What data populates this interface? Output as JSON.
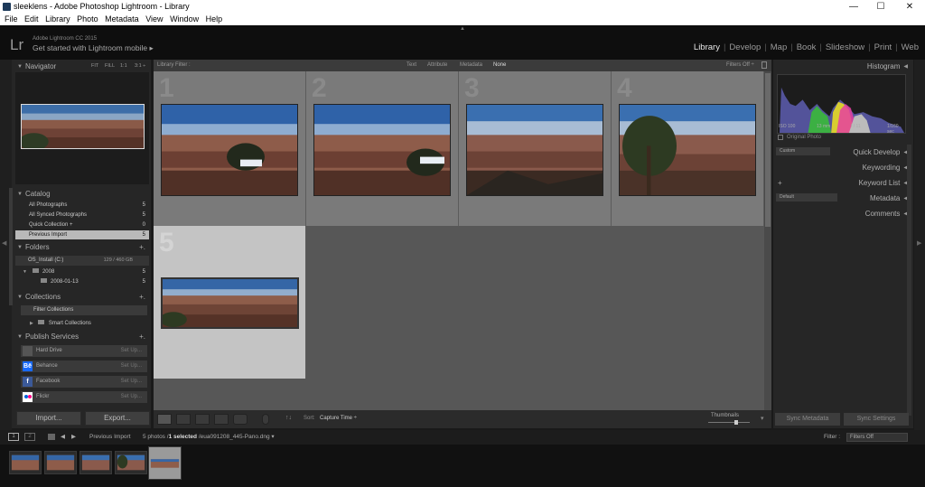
{
  "window": {
    "title": "sleeklens - Adobe Photoshop Lightroom - Library",
    "minimize": "—",
    "maximize": "☐",
    "close": "✕"
  },
  "menu": [
    "File",
    "Edit",
    "Library",
    "Photo",
    "Metadata",
    "View",
    "Window",
    "Help"
  ],
  "identity": {
    "logo": "Lr",
    "line1": "Adobe Lightroom CC 2015",
    "line2": "Get started with Lightroom mobile ▸"
  },
  "modules": [
    "Library",
    "Develop",
    "Map",
    "Book",
    "Slideshow",
    "Print",
    "Web"
  ],
  "navigator": {
    "title": "Navigator",
    "zooms": [
      "FIT",
      "FILL",
      "1:1",
      "3:1 ÷"
    ]
  },
  "catalog": {
    "title": "Catalog",
    "items": [
      {
        "label": "All Photographs",
        "count": "5"
      },
      {
        "label": "All Synced Photographs",
        "count": "5"
      },
      {
        "label": "Quick Collection +",
        "count": "0"
      },
      {
        "label": "Previous Import",
        "count": "5"
      }
    ]
  },
  "folders": {
    "title": "Folders",
    "volume": "OS_Install (C:)",
    "volume_info": "129 / 460 GB",
    "items": [
      {
        "label": "2008",
        "count": "5"
      },
      {
        "label": "2008-01-13",
        "count": "5"
      }
    ]
  },
  "collections": {
    "title": "Collections",
    "filter": "Filter Collections",
    "smart": "Smart Collections"
  },
  "publish": {
    "title": "Publish Services",
    "services": [
      {
        "name": "Hard Drive",
        "setup": "Set Up..."
      },
      {
        "name": "Behance",
        "setup": "Set Up..."
      },
      {
        "name": "Facebook",
        "setup": "Set Up..."
      },
      {
        "name": "Flickr",
        "setup": "Set Up..."
      }
    ]
  },
  "left_buttons": {
    "import": "Import...",
    "export": "Export..."
  },
  "filterbar": {
    "title": "Library Filter :",
    "options": [
      "Text",
      "Attribute",
      "Metadata",
      "None"
    ],
    "filters_off": "Filters Off ÷"
  },
  "grid": {
    "numbers": [
      "1",
      "2",
      "3",
      "4",
      "5"
    ]
  },
  "toolbar": {
    "sort_label": "Sort:",
    "sort_value": "Capture Time ÷",
    "thumbnails": "Thumbnails"
  },
  "right": {
    "histogram": "Histogram",
    "exif": [
      "ISO 100",
      "13 mm",
      "f / 11",
      "1/160 sec"
    ],
    "original_photo": "Original Photo",
    "quick_develop": "Quick Develop",
    "quick_develop_preset": "Custom",
    "keywording": "Keywording",
    "keyword_list": "Keyword List",
    "metadata": "Metadata",
    "metadata_preset": "Default",
    "comments": "Comments",
    "sync_metadata": "Sync Metadata",
    "sync_settings": "Sync Settings"
  },
  "filmnav": {
    "page1": "1",
    "page2": "2",
    "source": "Previous Import",
    "info_pre": "5 photos /",
    "info_sel": "1 selected",
    "info_file": "/eua091208_445-Pano.dng ▾",
    "filter_label": "Filter :",
    "filter_value": "Filters Off"
  },
  "colors": {
    "active_module": "#e6e6e6",
    "panel": "#262626",
    "grid_bg": "#575757",
    "cell": "#7a7a7a",
    "selected_cell": "#c4c4c4"
  }
}
